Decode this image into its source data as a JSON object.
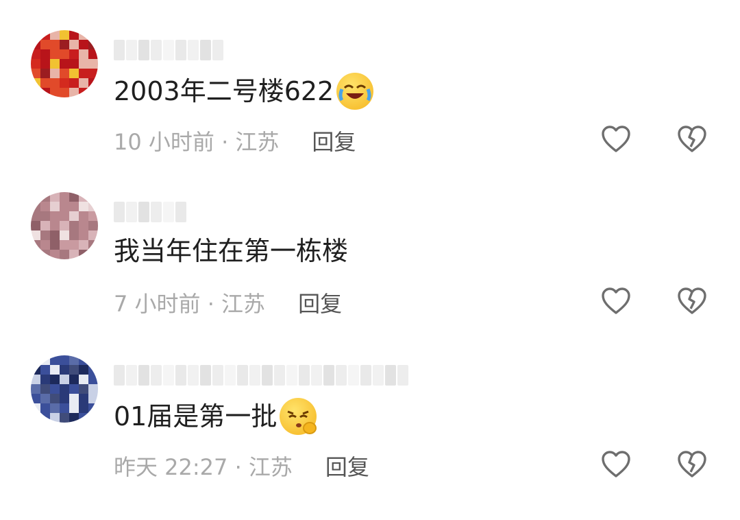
{
  "colors": {
    "text": "#1f1f1f",
    "meta": "#a9a9a9",
    "reply": "#555555",
    "icon": "#6e6e6e",
    "background": "#ffffff"
  },
  "comments": [
    {
      "username": "",
      "text": "2003年二号楼622",
      "emoji": "laughing-crying-emoji-icon",
      "time_location": "10 小时前 · 江苏",
      "reply_label": "回复",
      "avatar_palette": [
        "#b8141a",
        "#d42a1e",
        "#e14a2a",
        "#f1c232",
        "#c81e1e",
        "#9b1d21",
        "#e8b4a8"
      ]
    },
    {
      "username": "",
      "text": "我当年住在第一栋楼",
      "emoji": "",
      "time_location": "7 小时前 · 江苏",
      "reply_label": "回复",
      "avatar_palette": [
        "#d8b3b8",
        "#c99aa0",
        "#b9878e",
        "#e6cfd1",
        "#a7787f",
        "#efe1e1",
        "#8f6068"
      ]
    },
    {
      "username": "",
      "text": "01届是第一批",
      "emoji": "shushing-face-emoji-icon",
      "time_location": "昨天 22:27 · 江苏",
      "reply_label": "回复",
      "avatar_palette": [
        "#2a3a78",
        "#3b4f9a",
        "#1d2a5c",
        "#c9d1e6",
        "#5a6ca8",
        "#e8ebf3",
        "#404c7a"
      ]
    }
  ]
}
